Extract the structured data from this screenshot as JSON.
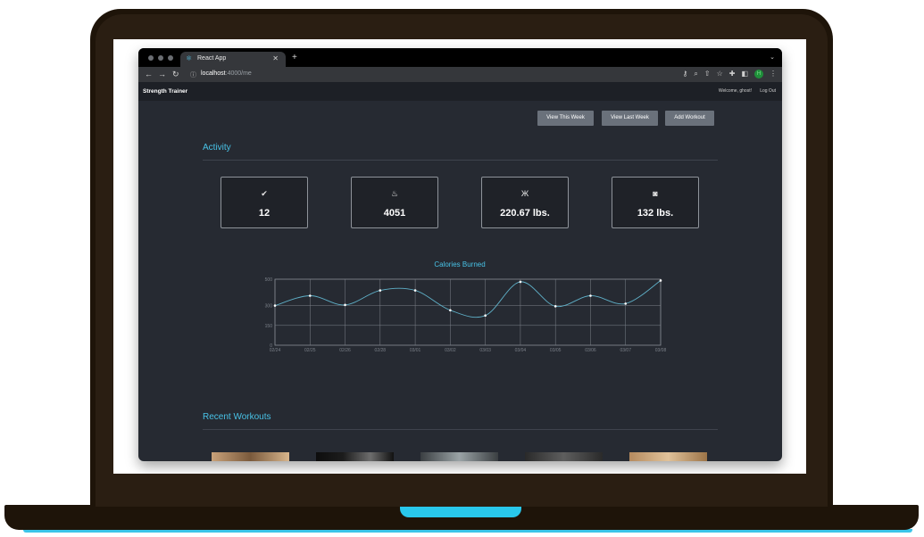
{
  "browser": {
    "tab_title": "React App",
    "tab_favicon": "react-icon",
    "new_tab": "+",
    "url_host": "localhost",
    "url_path": ":4000/me",
    "profile_initial": "H"
  },
  "app": {
    "brand": "Strength Trainer",
    "welcome": "Welcome, ghost!",
    "logout": "Log Out"
  },
  "toolbar": {
    "view_this_week": "View This Week",
    "view_last_week": "View Last Week",
    "add_workout": "Add Workout"
  },
  "activity": {
    "title": "Activity",
    "stats": [
      {
        "icon": "double-check-icon",
        "glyph": "✔",
        "value": "12"
      },
      {
        "icon": "flame-icon",
        "glyph": "♨",
        "value": "4051"
      },
      {
        "icon": "weightlifter-icon",
        "glyph": "Ж",
        "value": "220.67 lbs."
      },
      {
        "icon": "scale-icon",
        "glyph": "◙",
        "value": "132 lbs."
      }
    ]
  },
  "calories_chart": {
    "title": "Calories Burned"
  },
  "chart_data": {
    "type": "line",
    "title": "Calories Burned",
    "x": [
      "02/24",
      "02/25",
      "02/26",
      "02/28",
      "03/01",
      "03/02",
      "03/03",
      "03/04",
      "03/05",
      "03/06",
      "03/07",
      "03/08"
    ],
    "series": [
      {
        "values": [
          300,
          375,
          305,
          415,
          415,
          265,
          225,
          480,
          295,
          375,
          315,
          490
        ]
      }
    ],
    "ylim": [
      0,
      500
    ],
    "yticks": [
      0,
      150,
      300,
      500
    ],
    "grid": true,
    "line_color": "#5fb0c8"
  },
  "recent": {
    "title": "Recent Workouts"
  },
  "colors": {
    "accent": "#48c2e6",
    "app_bg": "#262a32",
    "laptop": "#1e1409",
    "button": "#6a717b"
  }
}
